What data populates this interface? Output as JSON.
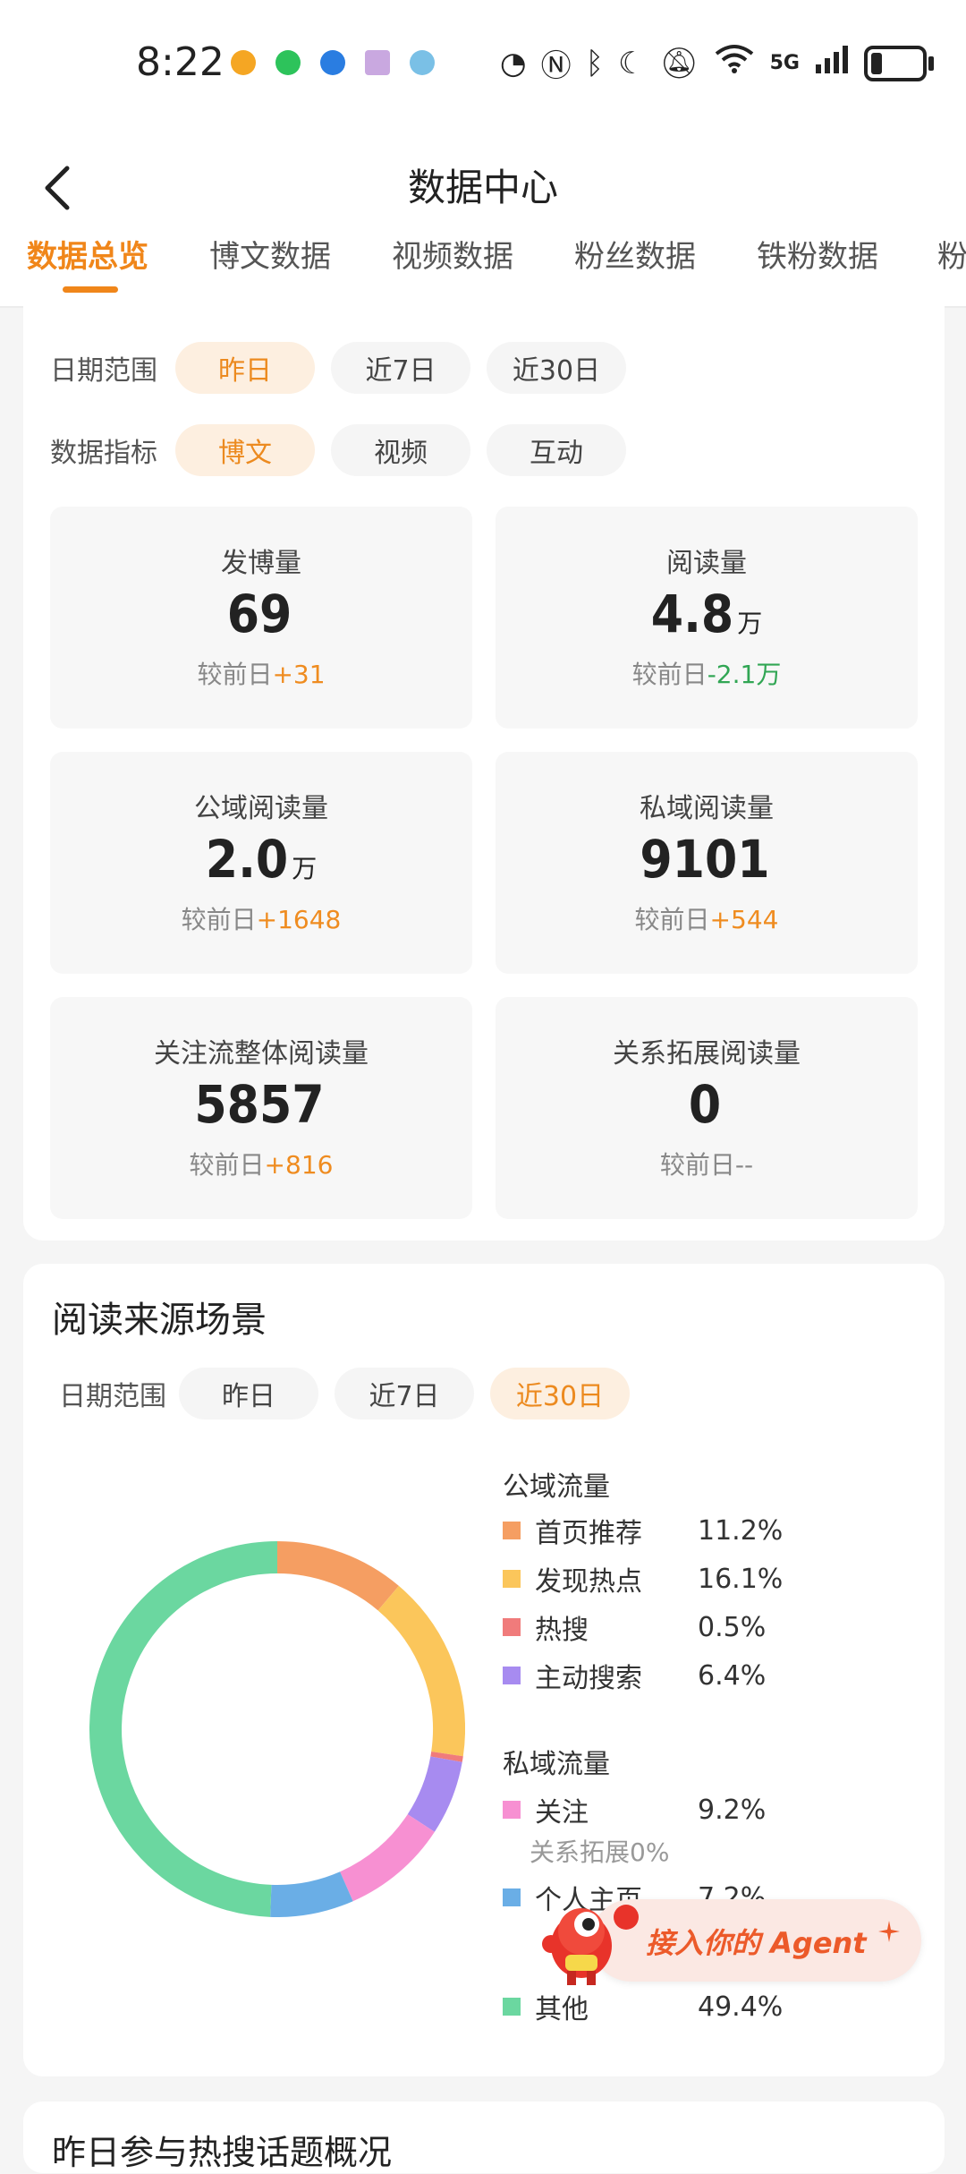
{
  "status_bar": {
    "time": "8:22",
    "network": "5G",
    "app_icons": [
      "weibo-icon",
      "wechat-icon",
      "transfer-icon",
      "mail-icon",
      "boat-icon"
    ],
    "system_icons": [
      "nfc-icon",
      "n-icon",
      "bluetooth-icon",
      "moon-icon",
      "mute-icon",
      "wifi-icon",
      "signal-icon",
      "battery-icon"
    ]
  },
  "header": {
    "title": "数据中心"
  },
  "tabs": [
    {
      "label": "数据总览",
      "active": true
    },
    {
      "label": "博文数据"
    },
    {
      "label": "视频数据"
    },
    {
      "label": "粉丝数据"
    },
    {
      "label": "铁粉数据"
    },
    {
      "label": "粉"
    }
  ],
  "overview": {
    "date_filter": {
      "label": "日期范围",
      "options": [
        "昨日",
        "近7日",
        "近30日"
      ],
      "selected": "昨日"
    },
    "metric_filter": {
      "label": "数据指标",
      "options": [
        "博文",
        "视频",
        "互动"
      ],
      "selected": "博文"
    },
    "compare_label": "较前日",
    "metrics": [
      {
        "label": "发博量",
        "value": "69",
        "unit": "",
        "delta": "+31",
        "trend": "up"
      },
      {
        "label": "阅读量",
        "value": "4.8",
        "unit": "万",
        "delta": "-2.1万",
        "trend": "down"
      },
      {
        "label": "公域阅读量",
        "value": "2.0",
        "unit": "万",
        "delta": "+1648",
        "trend": "up"
      },
      {
        "label": "私域阅读量",
        "value": "9101",
        "unit": "",
        "delta": "+544",
        "trend": "up"
      },
      {
        "label": "关注流整体阅读量",
        "value": "5857",
        "unit": "",
        "delta": "+816",
        "trend": "up"
      },
      {
        "label": "关系拓展阅读量",
        "value": "0",
        "unit": "",
        "delta": "--",
        "trend": "none"
      }
    ]
  },
  "read_sources": {
    "title": "阅读来源场景",
    "date_filter": {
      "label": "日期范围",
      "options": [
        "昨日",
        "近7日",
        "近30日"
      ],
      "selected": "近30日"
    },
    "public_title": "公域流量",
    "private_title": "私域流量",
    "relation_note": "关系拓展0%",
    "public_items": [
      {
        "name": "首页推荐",
        "value": "11.2%",
        "color": "#f59e62"
      },
      {
        "name": "发现热点",
        "value": "16.1%",
        "color": "#fbc65b"
      },
      {
        "name": "热搜",
        "value": "0.5%",
        "color": "#f07b7b"
      },
      {
        "name": "主动搜索",
        "value": "6.4%",
        "color": "#a78bf0"
      }
    ],
    "private_items": [
      {
        "name": "关注",
        "value": "9.2%",
        "color": "#f790d2"
      },
      {
        "name": "个人主页",
        "value": "7.2%",
        "color": "#6aaee6"
      },
      {
        "name": "其他",
        "value": "49.4%",
        "color": "#6bd7a0"
      }
    ]
  },
  "agent_button": {
    "label": "接入你的 Agent"
  },
  "hot_topics": {
    "title": "昨日参与热搜话题概况"
  },
  "chart_data": {
    "type": "pie",
    "title": "阅读来源场景",
    "donut": true,
    "categories": [
      "首页推荐",
      "发现热点",
      "热搜",
      "主动搜索",
      "关注",
      "个人主页",
      "其他"
    ],
    "values": [
      11.2,
      16.1,
      0.5,
      6.4,
      9.2,
      7.2,
      49.4
    ],
    "colors": [
      "#f59e62",
      "#fbc65b",
      "#f07b7b",
      "#a78bf0",
      "#f790d2",
      "#6aaee6",
      "#6bd7a0"
    ],
    "unit": "%"
  }
}
